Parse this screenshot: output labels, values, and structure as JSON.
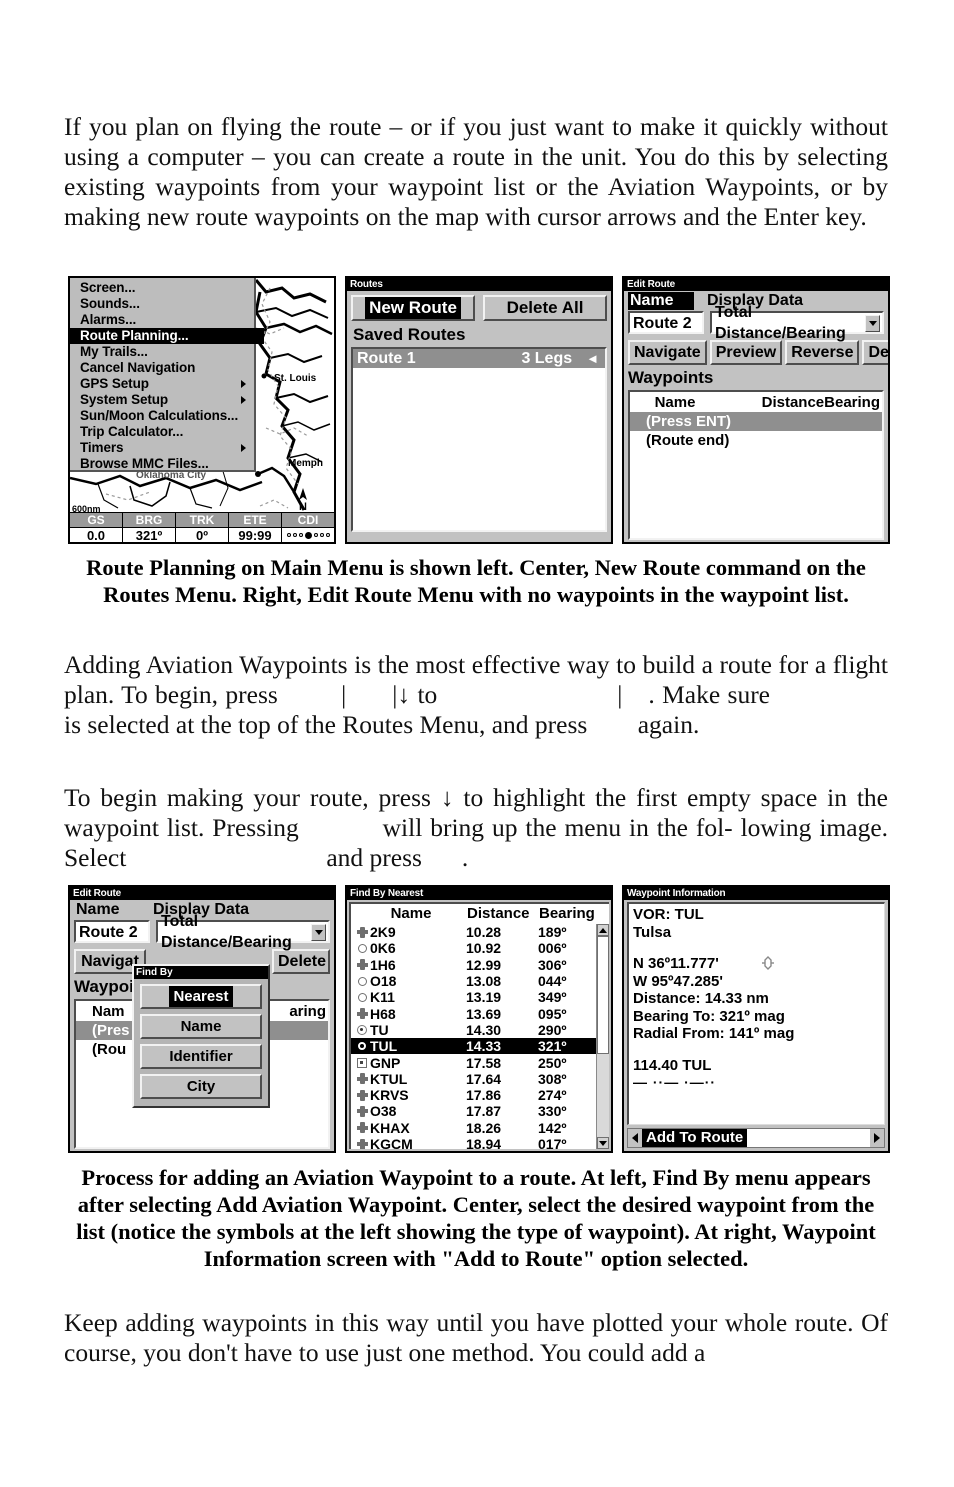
{
  "document": {
    "paragraph1": "If you plan on flying the route – or if you just want to make it quickly without using a computer – you can create a route in the unit. You do this by selecting existing waypoints from your waypoint list or the Aviation Waypoints, or by making new route waypoints on the map with cursor arrows and the Enter key.",
    "caption1": "Route Planning on Main Menu is shown left. Center, New Route command on the Routes Menu. Right, Edit Route Menu with no waypoints in the waypoint list.",
    "paragraph2_part1": "Adding Aviation Waypoints is the most effective way to build a route for a flight plan. To begin, press",
    "paragraph2_part2": "|",
    "paragraph2_part3": "|↓ to",
    "paragraph2_part4": "|",
    "paragraph2_part5": ".",
    "paragraph2_part6": "Make sure",
    "paragraph2_part7": "is selected at the top of the Routes Menu, and press",
    "paragraph2_part8": "again.",
    "paragraph3_part1": "To begin making your route, press ↓ to highlight the first empty space in the waypoint list. Pressing",
    "paragraph3_part2": "will bring up the menu in the fol-",
    "paragraph3_part3": "lowing image. Select",
    "paragraph3_part4": "and press",
    "paragraph3_part5": ".",
    "caption2": "Process for adding an Aviation Waypoint to a route. At left, Find By menu appears after selecting Add Aviation Waypoint. Center, select the desired waypoint from the list (notice the symbols at the left showing the type of waypoint). At right, Waypoint Information screen with \"Add to Route\" option selected.",
    "paragraph4": "Keep adding waypoints in this way until you have plotted your whole route. Of course, you don't have to use just one method. You could add a"
  },
  "panel_main_menu": {
    "menu_items": [
      {
        "label": "Screen...",
        "selected": false,
        "submenu": false
      },
      {
        "label": "Sounds...",
        "selected": false,
        "submenu": false
      },
      {
        "label": "Alarms...",
        "selected": false,
        "submenu": false
      },
      {
        "label": "Route Planning...",
        "selected": true,
        "submenu": false
      },
      {
        "label": "My Trails...",
        "selected": false,
        "submenu": false
      },
      {
        "label": "Cancel Navigation",
        "selected": false,
        "submenu": false
      },
      {
        "label": "GPS Setup",
        "selected": false,
        "submenu": true
      },
      {
        "label": "System Setup",
        "selected": false,
        "submenu": true
      },
      {
        "label": "Sun/Moon Calculations...",
        "selected": false,
        "submenu": false
      },
      {
        "label": "Trip Calculator...",
        "selected": false,
        "submenu": false
      },
      {
        "label": "Timers",
        "selected": false,
        "submenu": true
      },
      {
        "label": "Browse MMC Files...",
        "selected": false,
        "submenu": false
      }
    ],
    "map": {
      "scale": "600nm",
      "north_label": "N",
      "city_labels": [
        "St. Louis",
        "Memphis",
        "Oklahoma City"
      ]
    },
    "status_bar": [
      {
        "label": "GS",
        "value": "0.0"
      },
      {
        "label": "BRG",
        "value": "321º"
      },
      {
        "label": "TRK",
        "value": "0º"
      },
      {
        "label": "ETE",
        "value": "99:99"
      },
      {
        "label": "CDI",
        "value": ""
      }
    ]
  },
  "panel_routes": {
    "title": "Routes",
    "new_route_button": "New Route",
    "delete_all_button": "Delete All",
    "saved_routes_label": "Saved Routes",
    "routes": [
      {
        "name": "Route 1",
        "legs": "3 Legs",
        "selected": true
      }
    ]
  },
  "panel_edit_route": {
    "title": "Edit Route",
    "name_label": "Name",
    "display_data_label": "Display Data",
    "name_value": "Route 2",
    "display_data_value": "Total Distance/Bearing",
    "buttons": [
      "Navigate",
      "Preview",
      "Reverse",
      "Delete"
    ],
    "waypoints_label": "Waypoints",
    "columns": {
      "name": "Name",
      "distance": "Distance",
      "bearing": "Bearing"
    },
    "rows": [
      {
        "label": "(Press ENT)",
        "selected": true
      },
      {
        "label": "(Route end)",
        "selected": false
      }
    ]
  },
  "panel_find_by": {
    "title": "Edit Route",
    "name_label": "Name",
    "display_data_label": "Display Data",
    "name_value": "Route 2",
    "display_data_value": "Total Distance/Bearing",
    "buttons": [
      "Navigat",
      "Delete"
    ],
    "waypoints_label": "Waypoin",
    "columns": {
      "name": "Nam",
      "bearing": "aring"
    },
    "rows": [
      {
        "label": "(Pres",
        "selected": true
      },
      {
        "label": "(Rou",
        "selected": false
      }
    ],
    "popup": {
      "title": "Find By",
      "options": [
        {
          "label": "Nearest",
          "selected": true
        },
        {
          "label": "Name",
          "selected": false
        },
        {
          "label": "Identifier",
          "selected": false
        },
        {
          "label": "City",
          "selected": false
        }
      ]
    }
  },
  "panel_find_by_nearest": {
    "title": "Find By Nearest",
    "columns": {
      "name": "Name",
      "distance": "Distance",
      "bearing": "Bearing"
    },
    "rows": [
      {
        "symbol": "vortac-icon",
        "name": "2K9",
        "distance": "10.28",
        "bearing": "189º",
        "selected": false
      },
      {
        "symbol": "circle-icon",
        "name": "0K6",
        "distance": "10.92",
        "bearing": "006º",
        "selected": false
      },
      {
        "symbol": "vortac-icon",
        "name": "1H6",
        "distance": "12.99",
        "bearing": "306º",
        "selected": false
      },
      {
        "symbol": "circle-icon",
        "name": "O18",
        "distance": "13.08",
        "bearing": "044º",
        "selected": false
      },
      {
        "symbol": "circle-icon",
        "name": "K11",
        "distance": "13.19",
        "bearing": "349º",
        "selected": false
      },
      {
        "symbol": "vortac-icon",
        "name": "H68",
        "distance": "13.69",
        "bearing": "095º",
        "selected": false
      },
      {
        "symbol": "vor-icon",
        "name": "TU",
        "distance": "14.30",
        "bearing": "290º",
        "selected": false
      },
      {
        "symbol": "vor-icon",
        "name": "TUL",
        "distance": "14.33",
        "bearing": "321º",
        "selected": true
      },
      {
        "symbol": "square-icon",
        "name": "GNP",
        "distance": "17.58",
        "bearing": "250º",
        "selected": false
      },
      {
        "symbol": "vortac-icon",
        "name": "KTUL",
        "distance": "17.64",
        "bearing": "308º",
        "selected": false
      },
      {
        "symbol": "vortac-icon",
        "name": "KRVS",
        "distance": "17.86",
        "bearing": "274º",
        "selected": false
      },
      {
        "symbol": "vortac-icon",
        "name": "O38",
        "distance": "17.87",
        "bearing": "330º",
        "selected": false
      },
      {
        "symbol": "vortac-icon",
        "name": "KHAX",
        "distance": "18.26",
        "bearing": "142º",
        "selected": false
      },
      {
        "symbol": "vortac-icon",
        "name": "KGCM",
        "distance": "18.94",
        "bearing": "017º",
        "selected": false
      }
    ]
  },
  "panel_waypoint_info": {
    "title": "Waypoint Information",
    "line_type": "VOR: TUL",
    "line_city": "Tulsa",
    "lat": "N   36º11.777'",
    "lon": "W   95º47.285'",
    "distance": "Distance:      14.33 nm",
    "bearing_to": "Bearing To:  321º mag",
    "radial_from": "Radial From: 141º mag",
    "frequency": "114.40 TUL",
    "morse": "—  ··—  ·—··",
    "footer_button": "Add To Route"
  },
  "colors": {
    "screen_bg": "#ffffff",
    "panel_gray": "#c2c2c2",
    "selected_bg": "#000000",
    "row_highlight": "#8f8f8f",
    "titlebar": "#000000"
  }
}
